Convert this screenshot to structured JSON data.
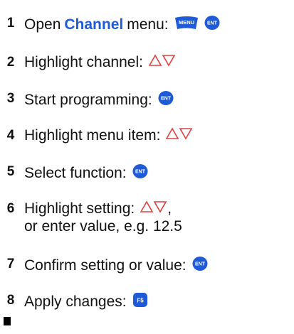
{
  "colors": {
    "accent_blue": "#1f5bd8",
    "arrow_red": "#e04040"
  },
  "steps": [
    {
      "num": "1",
      "pre": "Open",
      "keyword": "Channel",
      "post": "menu:",
      "keys": [
        "MENU",
        "ENT"
      ]
    },
    {
      "num": "2",
      "text": "Highlight channel:"
    },
    {
      "num": "3",
      "text": "Start programming:",
      "keys": [
        "ENT"
      ]
    },
    {
      "num": "4",
      "text": "Highlight menu item:"
    },
    {
      "num": "5",
      "text": "Select function:",
      "keys": [
        "ENT"
      ]
    },
    {
      "num": "6",
      "text": "Highlight setting:",
      "after": ",",
      "line2": "or enter value, e.g. 12.5"
    },
    {
      "num": "7",
      "text": "Confirm setting or value:",
      "keys": [
        "ENT"
      ]
    },
    {
      "num": "8",
      "text": "Apply changes:",
      "keys": [
        "F5"
      ]
    }
  ],
  "icons": {
    "menu_key": "menu-key-icon",
    "ent_key": "ent-key-icon",
    "f5_key": "f5-key-icon",
    "up_down_arrows": "up-down-arrows-icon"
  }
}
